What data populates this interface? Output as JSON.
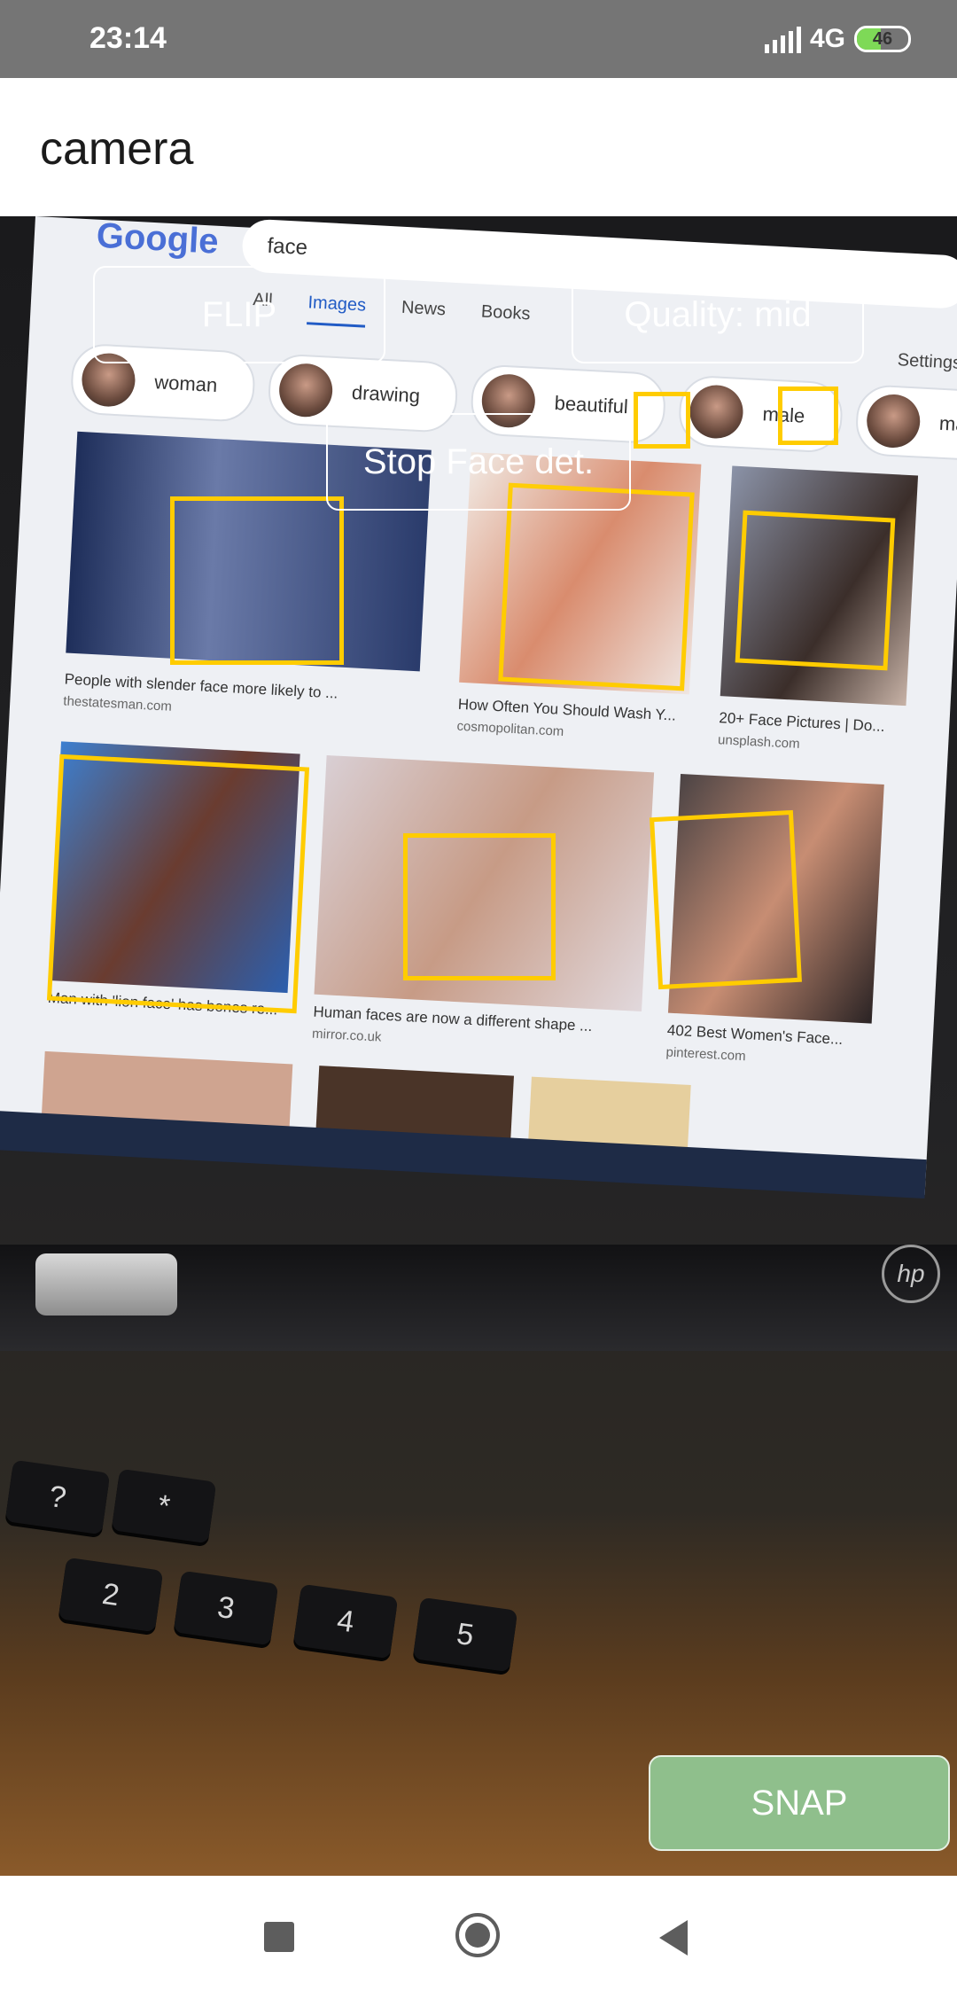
{
  "status_bar": {
    "time": "23:14",
    "network": "4G",
    "battery": "46",
    "battery_level": 0.46
  },
  "app_bar": {
    "title": "camera"
  },
  "overlay": {
    "flip_label": "FLIP",
    "quality_label": "Quality: mid",
    "face_detection_label": "Stop Face det.",
    "snap_label": "SNAP"
  },
  "viewfinder": {
    "search_logo": "Google",
    "search_query": "face",
    "tabs": [
      "All",
      "Images",
      "News",
      "Books"
    ],
    "settings_label": "Settings",
    "chips": [
      "woman",
      "drawing",
      "beautiful",
      "male",
      "makeup"
    ],
    "captions": [
      {
        "title": "People with slender face more likely to ...",
        "source": "thestatesman.com"
      },
      {
        "title": "How Often You Should Wash Y...",
        "source": "cosmopolitan.com"
      },
      {
        "title": "20+ Face Pictures | Do...",
        "source": "unsplash.com"
      },
      {
        "title": "Man with 'lion face' has bones re...",
        "source": ""
      },
      {
        "title": "Human faces are now a different shape ...",
        "source": "mirror.co.uk"
      },
      {
        "title": "402 Best Women's Face...",
        "source": "pinterest.com"
      }
    ],
    "keys": [
      "?",
      "*",
      "2",
      "3",
      "4",
      "5"
    ],
    "brand": "hp"
  },
  "colors": {
    "face_box": "#ffcc00",
    "snap_bg": "#8fbf8c",
    "status_bar": "#757575"
  }
}
